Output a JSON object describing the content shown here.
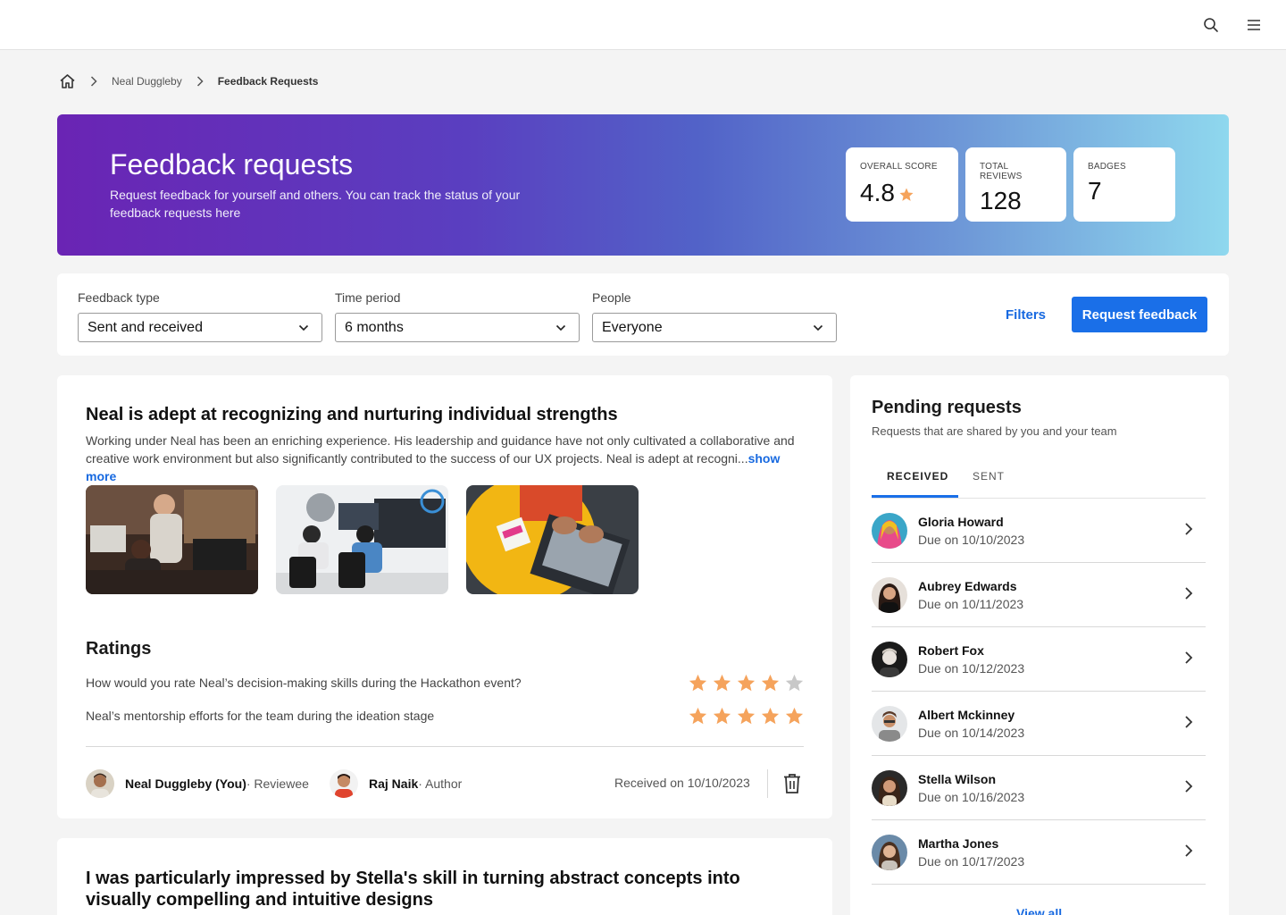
{
  "topbar": {
    "icons": [
      "search-icon",
      "menu-icon"
    ]
  },
  "breadcrumb": {
    "home_icon": "home-icon",
    "items": [
      "Neal Duggleby",
      "Feedback Requests"
    ]
  },
  "hero": {
    "title": "Feedback requests",
    "subtitle": "Request feedback for yourself and others. You can track the status of your feedback requests here",
    "stats": [
      {
        "label": "OVERALL SCORE",
        "value": "4.8"
      },
      {
        "label": "TOTAL REVIEWS",
        "value": "128"
      },
      {
        "label": "BADGES",
        "value": "7"
      }
    ],
    "gradient": [
      "#6a24b4",
      "#8fd8ee"
    ]
  },
  "filters": {
    "feedback_type": {
      "label": "Feedback type",
      "value": "Sent and received"
    },
    "time_period": {
      "label": "Time period",
      "value": "6 months"
    },
    "people": {
      "label": "People",
      "value": "Everyone"
    },
    "filters_link": "Filters",
    "request_button": "Request feedback"
  },
  "feedback_card": {
    "title": "Neal is adept at recognizing and nurturing individual strengths",
    "body": "Working under Neal has been an enriching experience. His leadership and guidance have not only cultivated a collaborative and creative work environment but also significantly contributed to the success of our UX projects. Neal is adept at recogni...",
    "show_more": "show more",
    "ratings_title": "Ratings",
    "ratings": [
      {
        "question": "How would you rate Neal’s decision-making skills during the Hackathon event?",
        "stars": 4,
        "max": 5
      },
      {
        "question": "Neal’s mentorship efforts for the team during the ideation stage",
        "stars": 5,
        "max": 5
      }
    ],
    "reviewee": {
      "name": "Neal Duggleby (You)",
      "role": " · Reviewee"
    },
    "author": {
      "name": "Raj Naik",
      "role": " · Author"
    },
    "received": "Received on 10/10/2023"
  },
  "feedback_card_2": {
    "title": "I was particularly impressed by Stella's skill in turning abstract concepts into visually compelling and intuitive designs"
  },
  "pending": {
    "title": "Pending requests",
    "subtitle": "Requests that are shared by you and your team",
    "tabs": [
      "RECEIVED",
      "SENT"
    ],
    "active_tab": "RECEIVED",
    "items": [
      {
        "name": "Gloria Howard",
        "due": "Due on 10/10/2023"
      },
      {
        "name": "Aubrey Edwards",
        "due": "Due on 10/11/2023"
      },
      {
        "name": "Robert Fox",
        "due": "Due on 10/12/2023"
      },
      {
        "name": "Albert Mckinney",
        "due": "Due on 10/14/2023"
      },
      {
        "name": "Stella Wilson",
        "due": "Due on 10/16/2023"
      },
      {
        "name": "Martha Jones",
        "due": "Due on 10/17/2023"
      }
    ],
    "view_all": "View all"
  },
  "colors": {
    "accent": "#1a6fe8",
    "star": "#f5a35c",
    "star_empty": "#c8c8c8"
  }
}
